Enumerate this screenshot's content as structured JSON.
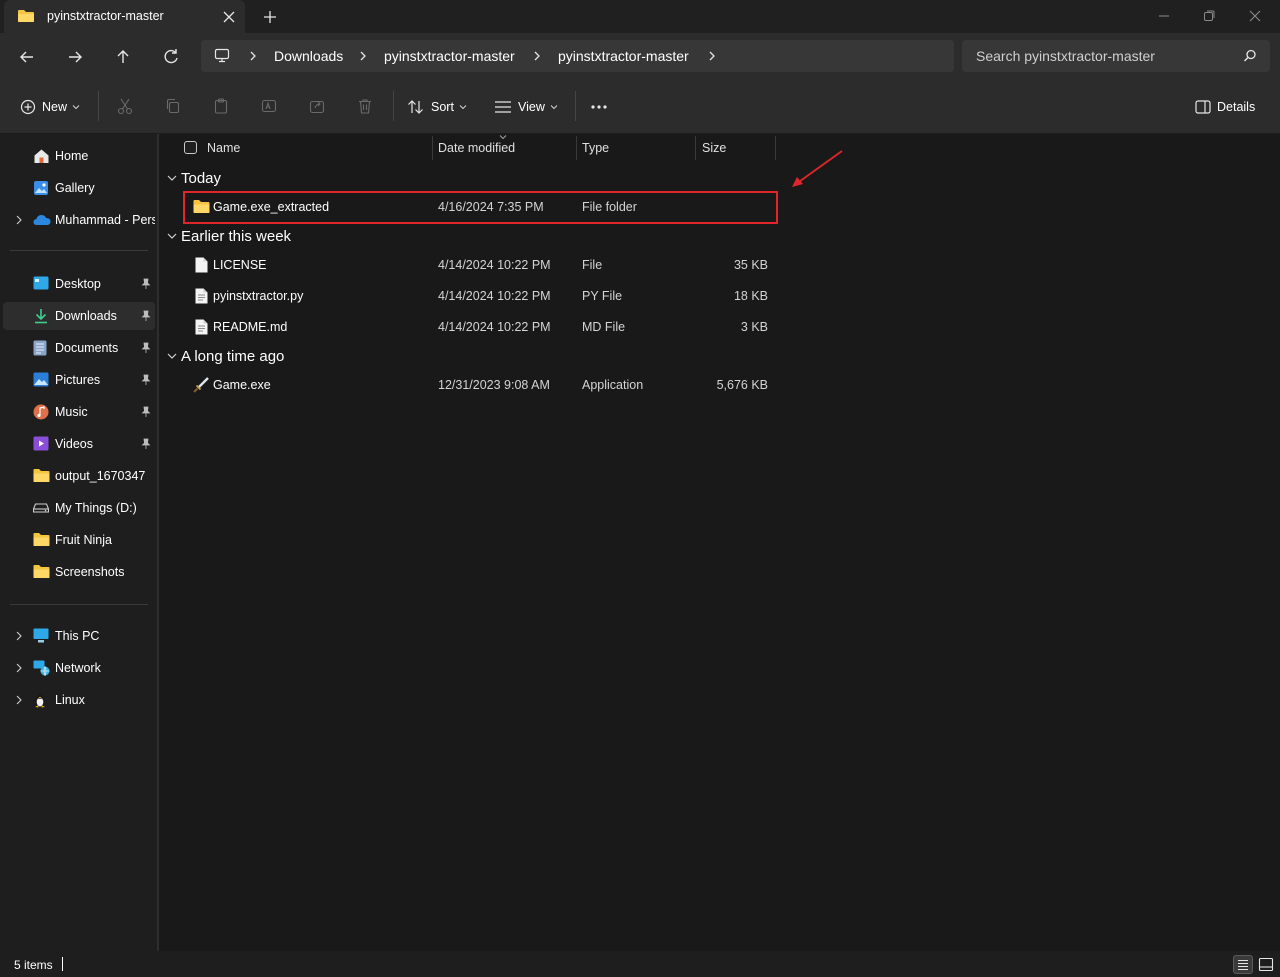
{
  "window": {
    "tab_title": "pyinstxtractor-master",
    "tab_icon": "folder-icon"
  },
  "address": {
    "crumbs": [
      "Downloads",
      "pyinstxtractor-master",
      "pyinstxtractor-master"
    ],
    "search_placeholder": "Search pyinstxtractor-master"
  },
  "toolbar": {
    "new_label": "New",
    "sort_label": "Sort",
    "view_label": "View",
    "details_label": "Details"
  },
  "sidebar": {
    "quick": [
      {
        "label": "Home",
        "icon": "home-icon"
      },
      {
        "label": "Gallery",
        "icon": "gallery-icon"
      },
      {
        "label": "Muhammad - Personal",
        "icon": "onedrive-cloud-icon"
      }
    ],
    "pinned": [
      {
        "label": "Desktop",
        "icon": "desktop-icon",
        "pinned": true
      },
      {
        "label": "Downloads",
        "icon": "downloads-icon",
        "pinned": true,
        "selected": true
      },
      {
        "label": "Documents",
        "icon": "documents-icon",
        "pinned": true
      },
      {
        "label": "Pictures",
        "icon": "pictures-icon",
        "pinned": true
      },
      {
        "label": "Music",
        "icon": "music-icon",
        "pinned": true
      },
      {
        "label": "Videos",
        "icon": "videos-icon",
        "pinned": true
      },
      {
        "label": "output_1670347",
        "icon": "folder-icon"
      },
      {
        "label": "My Things (D:)",
        "icon": "drive-icon"
      },
      {
        "label": "Fruit Ninja",
        "icon": "folder-icon"
      },
      {
        "label": "Screenshots",
        "icon": "folder-icon"
      }
    ],
    "devices": [
      {
        "label": "This PC",
        "icon": "this-pc-icon"
      },
      {
        "label": "Network",
        "icon": "network-icon"
      },
      {
        "label": "Linux",
        "icon": "linux-penguin-icon"
      }
    ]
  },
  "columns": {
    "name": "Name",
    "date": "Date modified",
    "type": "Type",
    "size": "Size"
  },
  "groups": [
    {
      "label": "Today",
      "items": [
        {
          "name": "Game.exe_extracted",
          "date": "4/16/2024 7:35 PM",
          "type": "File folder",
          "size": "",
          "icon": "folder-icon"
        }
      ]
    },
    {
      "label": "Earlier this week",
      "items": [
        {
          "name": "LICENSE",
          "date": "4/14/2024 10:22 PM",
          "type": "File",
          "size": "35 KB",
          "icon": "file-icon"
        },
        {
          "name": "pyinstxtractor.py",
          "date": "4/14/2024 10:22 PM",
          "type": "PY File",
          "size": "18 KB",
          "icon": "text-file-icon"
        },
        {
          "name": "README.md",
          "date": "4/14/2024 10:22 PM",
          "type": "MD File",
          "size": "3 KB",
          "icon": "text-file-icon"
        }
      ]
    },
    {
      "label": "A long time ago",
      "items": [
        {
          "name": "Game.exe",
          "date": "12/31/2023 9:08 AM",
          "type": "Application",
          "size": "5,676 KB",
          "icon": "sword-app-icon"
        }
      ]
    }
  ],
  "status": {
    "items_count": "5 items"
  },
  "colors": {
    "accent_highlight": "#e0262b",
    "folder": "#f5c542",
    "background": "#191919"
  }
}
